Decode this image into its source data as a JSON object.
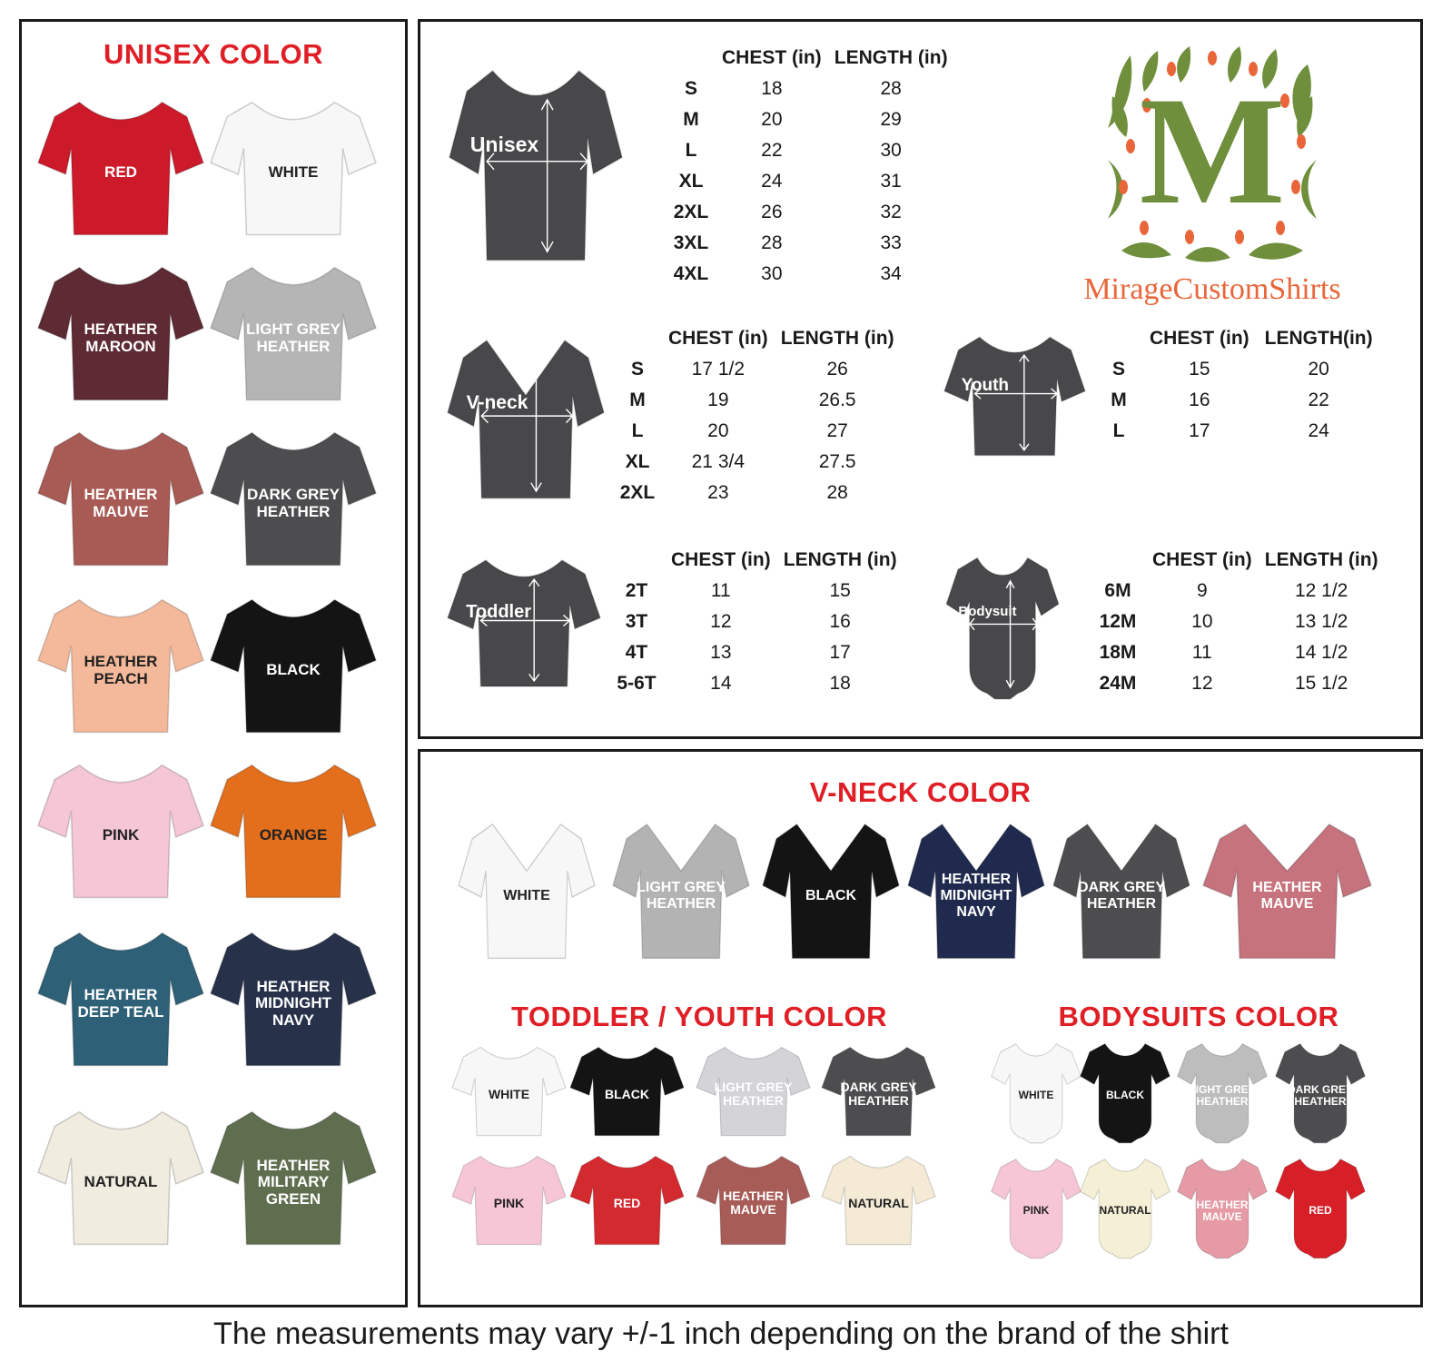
{
  "unisex": {
    "title": "UNISEX COLOR",
    "items": [
      {
        "label": "RED",
        "color": "#cc1a2a",
        "text": "#ffffff"
      },
      {
        "label": "WHITE",
        "color": "#f7f7f7",
        "text": "#222222"
      },
      {
        "label": "HEATHER\nMAROON",
        "color": "#5e2a33",
        "text": "#ffffff"
      },
      {
        "label": "LIGHT GREY\nHEATHER",
        "color": "#b5b5b5",
        "text": "#ffffff"
      },
      {
        "label": "HEATHER\nMAUVE",
        "color": "#a85a55",
        "text": "#ffffff"
      },
      {
        "label": "DARK GREY\nHEATHER",
        "color": "#4d4d4f",
        "text": "#ffffff"
      },
      {
        "label": "HEATHER\nPEACH",
        "color": "#f4b99a",
        "text": "#222222"
      },
      {
        "label": "BLACK",
        "color": "#141414",
        "text": "#ffffff"
      },
      {
        "label": "PINK",
        "color": "#f4c6d6",
        "text": "#222222"
      },
      {
        "label": "ORANGE",
        "color": "#e36e1c",
        "text": "#222222"
      },
      {
        "label": "HEATHER\nDEEP TEAL",
        "color": "#2e6077",
        "text": "#ffffff"
      },
      {
        "label": "HEATHER\nMIDNIGHT\nNAVY",
        "color": "#27324a",
        "text": "#ffffff"
      },
      {
        "label": "NATURAL",
        "color": "#f1ece0",
        "text": "#222222"
      },
      {
        "label": "HEATHER\nMILITARY\nGREEN",
        "color": "#5f6e4f",
        "text": "#ffffff"
      }
    ]
  },
  "sizes": {
    "unisex": {
      "badge": "Unisex",
      "headers": [
        "CHEST (in)",
        "LENGTH (in)"
      ],
      "rows": [
        [
          "S",
          "18",
          "28"
        ],
        [
          "M",
          "20",
          "29"
        ],
        [
          "L",
          "22",
          "30"
        ],
        [
          "XL",
          "24",
          "31"
        ],
        [
          "2XL",
          "26",
          "32"
        ],
        [
          "3XL",
          "28",
          "33"
        ],
        [
          "4XL",
          "30",
          "34"
        ]
      ]
    },
    "vneck": {
      "badge": "V-neck",
      "headers": [
        "CHEST (in)",
        "LENGTH (in)"
      ],
      "rows": [
        [
          "S",
          "17 1/2",
          "26"
        ],
        [
          "M",
          "19",
          "26.5"
        ],
        [
          "L",
          "20",
          "27"
        ],
        [
          "XL",
          "21 3/4",
          "27.5"
        ],
        [
          "2XL",
          "23",
          "28"
        ]
      ]
    },
    "youth": {
      "badge": "Youth",
      "headers": [
        "CHEST (in)",
        "LENGTH(in)"
      ],
      "rows": [
        [
          "S",
          "15",
          "20"
        ],
        [
          "M",
          "16",
          "22"
        ],
        [
          "L",
          "17",
          "24"
        ]
      ]
    },
    "toddler": {
      "badge": "Toddler",
      "headers": [
        "CHEST (in)",
        "LENGTH (in)"
      ],
      "rows": [
        [
          "2T",
          "11",
          "15"
        ],
        [
          "3T",
          "12",
          "16"
        ],
        [
          "4T",
          "13",
          "17"
        ],
        [
          "5-6T",
          "14",
          "18"
        ]
      ]
    },
    "bodysuit": {
      "badge": "Bodysuit",
      "headers": [
        "CHEST (in)",
        "LENGTH (in)"
      ],
      "rows": [
        [
          "6M",
          "9",
          "12 1/2"
        ],
        [
          "12M",
          "10",
          "13 1/2"
        ],
        [
          "18M",
          "11",
          "14 1/2"
        ],
        [
          "24M",
          "12",
          "15 1/2"
        ]
      ]
    }
  },
  "brand": {
    "logo_letter": "M",
    "name": "MirageCustomShirts",
    "green": "#6f8f3c",
    "orange": "#e8663a"
  },
  "vneck_colors": {
    "title": "V-NECK COLOR",
    "items": [
      {
        "label": "WHITE",
        "color": "#f7f7f7",
        "text": "#222222"
      },
      {
        "label": "LIGHT GREY\nHEATHER",
        "color": "#b3b3b3",
        "text": "#ffffff"
      },
      {
        "label": "BLACK",
        "color": "#141414",
        "text": "#ffffff"
      },
      {
        "label": "HEATHER\nMIDNIGHT\nNAVY",
        "color": "#202a4e",
        "text": "#ffffff"
      },
      {
        "label": "DARK GREY\nHEATHER",
        "color": "#4d4d4f",
        "text": "#ffffff"
      },
      {
        "label": "HEATHER\nMAUVE",
        "color": "#c6737e",
        "text": "#ffffff"
      }
    ]
  },
  "toddler_colors": {
    "title": "TODDLER / YOUTH COLOR",
    "items": [
      {
        "label": "WHITE",
        "color": "#f7f7f7",
        "text": "#222222"
      },
      {
        "label": "BLACK",
        "color": "#141414",
        "text": "#ffffff"
      },
      {
        "label": "LIGHT GREY\nHEATHER",
        "color": "#d3d3d8",
        "text": "#ffffff"
      },
      {
        "label": "DARK GREY\nHEATHER",
        "color": "#4d4d4f",
        "text": "#ffffff"
      },
      {
        "label": "PINK",
        "color": "#f6c6d6",
        "text": "#222222"
      },
      {
        "label": "RED",
        "color": "#d32a30",
        "text": "#ffffff"
      },
      {
        "label": "HEATHER\nMAUVE",
        "color": "#a85c58",
        "text": "#ffffff"
      },
      {
        "label": "NATURAL",
        "color": "#f4ead6",
        "text": "#222222"
      }
    ]
  },
  "bodysuit_colors": {
    "title": "BODYSUITS COLOR",
    "items": [
      {
        "label": "WHITE",
        "color": "#f7f7f7",
        "text": "#222222"
      },
      {
        "label": "BLACK",
        "color": "#141414",
        "text": "#ffffff"
      },
      {
        "label": "LIGHT GREY\nHEATHER",
        "color": "#bdbdbd",
        "text": "#ffffff"
      },
      {
        "label": "DARK GREY\nHEATHER",
        "color": "#4d4d4f",
        "text": "#ffffff"
      },
      {
        "label": "PINK",
        "color": "#f6c6d6",
        "text": "#222222"
      },
      {
        "label": "NATURAL",
        "color": "#f5efd6",
        "text": "#222222"
      },
      {
        "label": "HEATHER\nMAUVE",
        "color": "#e59aa5",
        "text": "#ffffff"
      },
      {
        "label": "RED",
        "color": "#d61f26",
        "text": "#ffffff"
      }
    ]
  },
  "footer": "The measurements may vary +/-1 inch depending on the brand of the shirt"
}
